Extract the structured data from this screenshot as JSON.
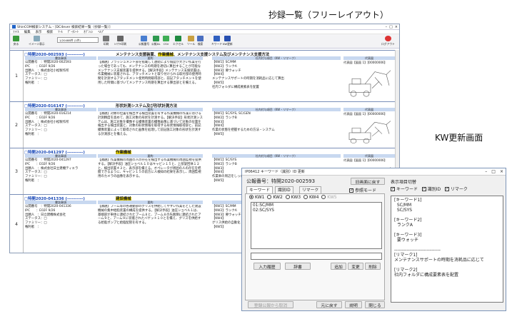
{
  "captions": {
    "main": "抄録一覧（フリーレイアウト）",
    "kw": "KW更新画面"
  },
  "main": {
    "title": "ShinCOM検索システム - [DC4ever 検索結果一覧（抄録一覧）]",
    "menu": [
      "ﾌｧｲﾙ",
      "編集",
      "表示",
      "検索",
      "ﾂｰﾙ",
      "ﾃﾞｰﾀｼｰﾄ",
      "ｵﾌﾟｼｮﾝ",
      "ﾍﾙﾌﾟ"
    ],
    "toolbar": {
      "back": "戻る",
      "image": "イメージ表示",
      "count": "1/20488件 (1件)",
      "print": "印刷",
      "layout_print": "ﾚｲｱｳﾄ印刷",
      "sub1": "公報番号",
      "sub2": "公報DL",
      "sub3": "CSV",
      "sub4": "エクセル",
      "tool": "ツール",
      "search": "検索",
      "kw": "キワード",
      "kw2": "KW更新",
      "exit": "ログアウト"
    },
    "docs": [
      {
        "no": "1",
        "id": "□特開2020-002593 (----------)",
        "title_a": "メンテナンス支援装置、",
        "title_hl": "作業機械",
        "title_b": "、メンテナンス支援システム及びメンテナンス支援方法",
        "bib": [
          "公開番号　：特開2020-002593",
          "IPC　　：E02F 9/26",
          "出願人　：株式会社小松製作所",
          "ステータス：□",
          "ファミリー：□",
          "権利者　："
        ],
        "abs": "【課題】ブラッシュメント部を搭載して連続により角度が大きい作業を行った場合であっても、メンテナンスの時期を適切に算出することが可能なメンテナンス支援装置を提供する。【解決手段】メンテナンス支援装置は、作業機械に装着される、アタッチメントと取り付けられる取付部の使用時間を計測するアタッチメント使用時間取得部と、前記アタッチメントを使用した時間に基づいてメンテナンス時期を算出する算出部とを備える。",
        "kw": [
          "【KW1】SC/MM",
          "【KW2】ランクA",
          "【KW3】要ウォッチ",
          "",
          "【KW4】",
          "メンテナンスサポートの時期を消耗品に応じて算出",
          "【KW5】",
          "社内フォルダに構成要素表を配置"
        ],
        "fig": "代表図【図面 1】【00000006】"
      },
      {
        "no": "2",
        "id": "□特開2020-016147 (----------)",
        "title_a": "形状計測システム及び形状計測方法",
        "title_hl": "",
        "title_b": "",
        "bib": [
          "公開番号　：特開2020-016214",
          "IPC　　：E02F 9/26",
          "出願人　：株式会社小松製作所",
          "ステータス：□",
          "ファミリー：□",
          "権利者　："
        ],
        "abs": "【課題】対象の位置を検出する検出装置を有する作業機械の作業における計測精度を高めて、施工対象の形状を計測する。【解決手段】形状計測システムは、施工対象を撮像する撮像装置の撮像画像に基づいて対象の位置を検出する検出装置と、対象の形状情報を取得する形状情報取得部と、前記撮像装置によって取得された画像を処理して前記施工対象の形状を計測する計測部とを備える。",
        "kw": [
          "【KW1】SC/SYS, SC/GEN",
          "【KW2】ランクB",
          "【KW3】",
          "",
          "【KW4】",
          "作業の状態を把握するための方法・システム",
          "【KW5】"
        ],
        "fig": "代表図【図面 1】【00000006】"
      },
      {
        "no": "3",
        "id": "□特開2020-041297 (----------)",
        "title_a": "",
        "title_hl": "作業機械",
        "title_b": "",
        "bib": [
          "公開番号　：特開2020-041297",
          "IPC　　：E02F 9/26",
          "出願人　：株式会社日立建機ティエラ",
          "ステータス：□",
          "ファミリー：□",
          "権利者　："
        ],
        "abs": "【課題】作業機械の周囲の人の存在を検出する作業機械の周囲監視を提供する。【解決手段】油圧ショベル１０はキャビン１５と、上部旋回体１２と、検出装置４３と、表示部を備える。オペレータが周囲の人の存在を把握できるように、キャビン１５の前方に人検知の結果を表示し、周囲監視用のカメラの画像を表示する。",
        "kw": [
          "【KW1】SC/SYS",
          "【KW2】ランクB",
          "【KW3】",
          "",
          "【KW4】",
          "作業車の周辺をしっかり捉える",
          "【KW5】"
        ],
        "fig": "代表図【図面 1】【00000006】"
      },
      {
        "no": "4",
        "id": "□特開2020-041336 (----------)",
        "title_a": "",
        "title_hl": "建設機械",
        "title_b": "",
        "bib": [
          "公開番号　：特開2020-041336",
          "IPC　　：E02F 9/26",
          "出願人　：日立建機株式会社",
          "ステータス：□",
          "ファミリー：□",
          "権利者　："
        ],
        "abs": "【課題】ブーム等の各運動部のグリスを供給してやすい作業をとした建設機械の集中給脂装置の構成を提供する。【解決手段】油圧ショベル１は、基端部が車体に連結されたブーム８と、ブーム８の先端側に連結されたアーム９と、アーム９に装着されたバケット１０とを備え、グリスを供給する給脂ポンプと給脂配管を有する。",
        "kw": [
          "【KW1】SC/MM",
          "【KW2】ランクA",
          "【KW3】要ウォッチ",
          "",
          "【KW4】",
          "グリス供給の自動化",
          "【KW5】"
        ],
        "fig": "代表図【図面 1】【00000006】"
      }
    ],
    "headers": {
      "bib": "書誌事項",
      "abs": "要約",
      "kw": "社内付与項目（KW・リマーク）",
      "fig": "代表図"
    }
  },
  "dialog": {
    "title": "IP06412 キーワード（識別）ID 更新",
    "pubno": "公報番号：特開2020-002593",
    "back_btn": "旧画面に戻す",
    "ref_mode": "参照モード",
    "tabs": [
      "キーワード",
      "識別ID",
      "リマーク"
    ],
    "radios": [
      "KW1",
      "KW2",
      "KW3",
      "KW4",
      "KW5"
    ],
    "kw_text": "01:SC/MM\n02:SC/SYS",
    "btns": {
      "history": "入力履歴",
      "dict": "辞書",
      "add": "追加",
      "mod": "変更",
      "del": "削除",
      "restore": "登録公報から取消",
      "prev": "元に戻す",
      "help": "説明",
      "close": "閉じる"
    },
    "disp_label": "表示項目切替",
    "disp_checks": [
      "キーワード",
      "識別ID",
      "リマーク"
    ],
    "preview": "[キーワード1]\n  SC/MM\n  SC/SYS\n\n[キーワード2]\n  ランクA\n\n[キーワード3]\n  要ウォッチ\n\n------------------------------\n[リマーク1]\nメンテナンスサポートの時期を消耗品に応じて\n\n[リマーク2]\n社内フォルダに構成要素表を配置"
  }
}
